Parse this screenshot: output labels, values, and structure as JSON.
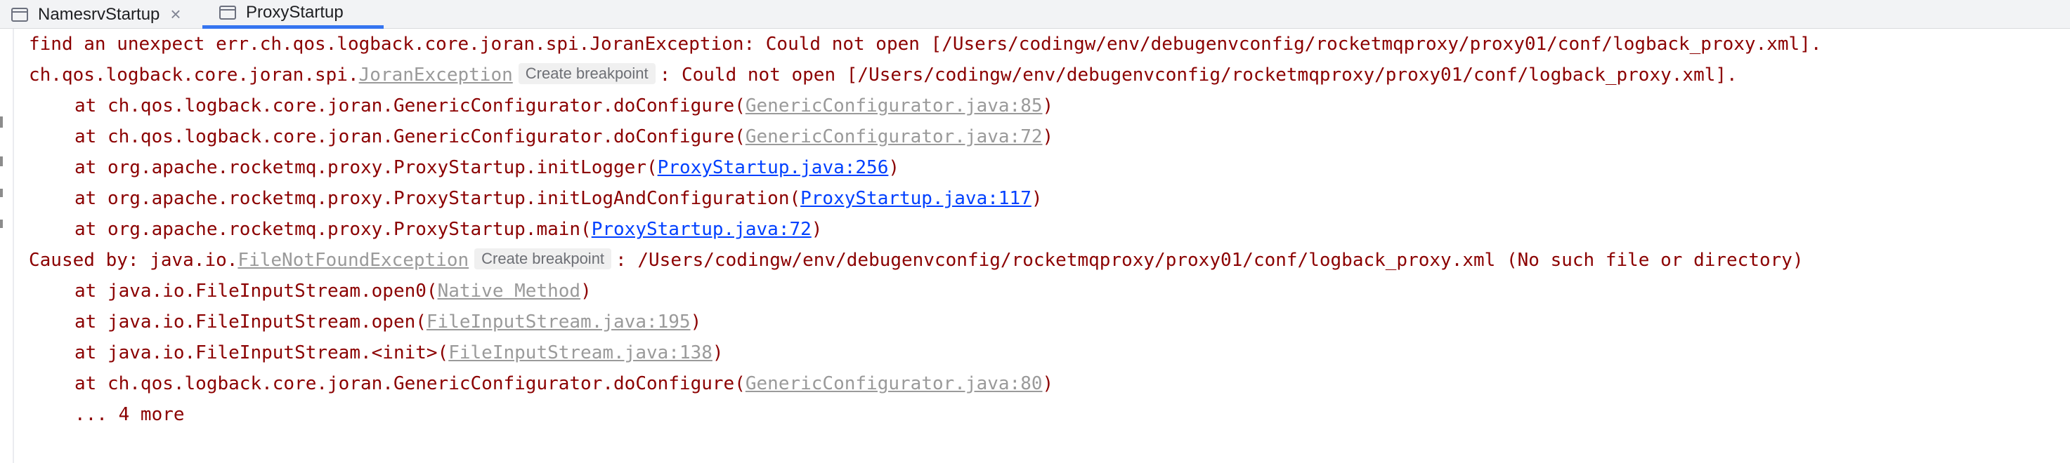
{
  "tabs": [
    {
      "label": "NamesrvStartup",
      "close": "×",
      "active": false
    },
    {
      "label": "ProxyStartup",
      "active": true
    }
  ],
  "colors": {
    "error_text": "#8b0000",
    "gray_link": "#9a9a9a",
    "blue_link": "#0040ff",
    "active_tab_underline": "#3574f0"
  },
  "console": {
    "line1": "find an unexpect err.ch.qos.logback.core.joran.spi.JoranException: Could not open [/Users/codingw/env/debugenvconfig/rocketmqproxy/proxy01/conf/logback_proxy.xml].",
    "line2": {
      "prefix": "ch.qos.logback.core.joran.spi.",
      "exception_link": "JoranException",
      "breakpoint_label": "Create breakpoint",
      "suffix": ": Could not open [/Users/codingw/env/debugenvconfig/rocketmqproxy/proxy01/conf/logback_proxy.xml]."
    },
    "frames1": [
      {
        "method": "at ch.qos.logback.core.joran.GenericConfigurator.doConfigure(",
        "link": "GenericConfigurator.java:85",
        "link_style": "gray",
        "tail": ")"
      },
      {
        "method": "at ch.qos.logback.core.joran.GenericConfigurator.doConfigure(",
        "link": "GenericConfigurator.java:72",
        "link_style": "gray",
        "tail": ")"
      },
      {
        "method": "at org.apache.rocketmq.proxy.ProxyStartup.initLogger(",
        "link": "ProxyStartup.java:256",
        "link_style": "blue",
        "tail": ")"
      },
      {
        "method": "at org.apache.rocketmq.proxy.ProxyStartup.initLogAndConfiguration(",
        "link": "ProxyStartup.java:117",
        "link_style": "blue",
        "tail": ")"
      },
      {
        "method": "at org.apache.rocketmq.proxy.ProxyStartup.main(",
        "link": "ProxyStartup.java:72",
        "link_style": "blue",
        "tail": ")"
      }
    ],
    "caused_by": {
      "prefix": "Caused by: java.io.",
      "exception_link": "FileNotFoundException",
      "breakpoint_label": "Create breakpoint",
      "suffix": ": /Users/codingw/env/debugenvconfig/rocketmqproxy/proxy01/conf/logback_proxy.xml (No such file or directory)"
    },
    "frames2": [
      {
        "method": "at java.io.FileInputStream.open0(",
        "link": "Native Method",
        "link_style": "gray",
        "tail": ")"
      },
      {
        "method": "at java.io.FileInputStream.open(",
        "link": "FileInputStream.java:195",
        "link_style": "gray",
        "tail": ")"
      },
      {
        "method": "at java.io.FileInputStream.<init>(",
        "link": "FileInputStream.java:138",
        "link_style": "gray",
        "tail": ")"
      },
      {
        "method": "at ch.qos.logback.core.joran.GenericConfigurator.doConfigure(",
        "link": "GenericConfigurator.java:80",
        "link_style": "gray",
        "tail": ")"
      }
    ],
    "more": "... 4 more"
  }
}
